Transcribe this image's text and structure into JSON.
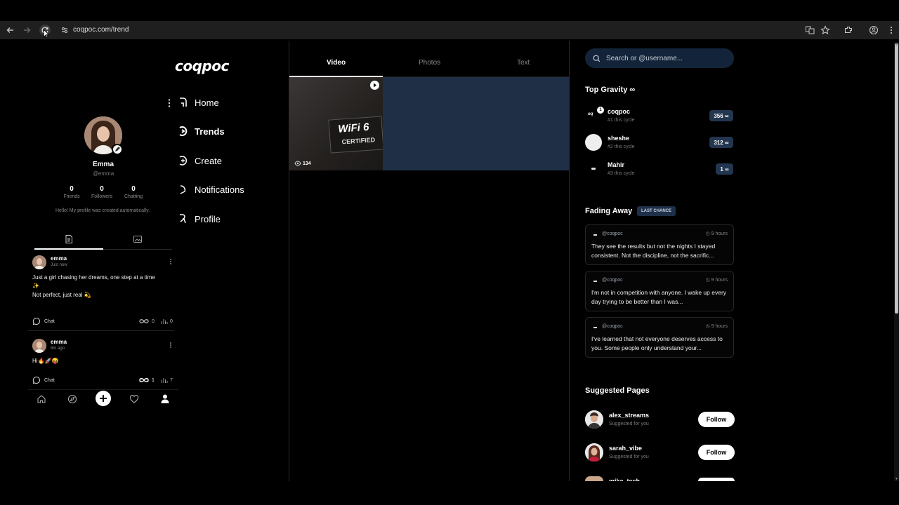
{
  "browser": {
    "url": "coqpoc.com/trend"
  },
  "brand": {
    "logo": "coqpoc"
  },
  "nav": {
    "items": [
      {
        "label": "Home"
      },
      {
        "label": "Trends"
      },
      {
        "label": "Create"
      },
      {
        "label": "Notifications"
      },
      {
        "label": "Profile"
      }
    ]
  },
  "profile": {
    "name": "Emma",
    "handle": "@emma",
    "stats": [
      {
        "value": "0",
        "label": "Friends"
      },
      {
        "value": "0",
        "label": "Followers"
      },
      {
        "value": "0",
        "label": "Chatting"
      }
    ],
    "bio": "Hello! My profile was created automatically."
  },
  "posts": [
    {
      "author": "emma",
      "time": "Just now",
      "line1": "Just a girl chasing her dreams, one step at a time",
      "line2": "✨",
      "line3": "Not perfect, just real 💫",
      "chat": "Chat",
      "gravity": "0",
      "views": "0"
    },
    {
      "author": "emma",
      "time": "8m ago",
      "line1": "Hi🔥🚀😝",
      "chat": "Chat",
      "gravity": "1",
      "views": "7"
    }
  ],
  "feed": {
    "tabs": [
      {
        "label": "Video"
      },
      {
        "label": "Photos"
      },
      {
        "label": "Text"
      }
    ],
    "video_views": "134",
    "thumb_line1": "WiFi 6",
    "thumb_line2": "CERTIFIED"
  },
  "search": {
    "placeholder": "Search or @username..."
  },
  "top_gravity": {
    "title": "Top Gravity ∞",
    "users": [
      {
        "name": "coqpoc",
        "rank": "#1 this cycle",
        "score": "356 ∞",
        "badge": "1"
      },
      {
        "name": "sheshe",
        "rank": "#2 this cycle",
        "score": "312 ∞"
      },
      {
        "name": "Mahir",
        "rank": "#3 this cycle",
        "score": "1 ∞"
      }
    ]
  },
  "fading": {
    "title": "Fading Away",
    "badge": "LAST CHANCE",
    "cards": [
      {
        "author": "@coqpoc",
        "time": "9 hours",
        "text": "They see the results but not the nights I stayed consistent. Not the discipline, not the sacrific..."
      },
      {
        "author": "@coqpoc",
        "time": "9 hours",
        "text": "I'm not in competition with anyone. I wake up every day trying to be better than I was..."
      },
      {
        "author": "@coqpoc",
        "time": "9 hours",
        "text": "I've learned that not everyone deserves access to you. Some people only understand your..."
      }
    ]
  },
  "suggested": {
    "title": "Suggested Pages",
    "items": [
      {
        "name": "alex_streams",
        "sub": "Suggested for you",
        "button": "Follow"
      },
      {
        "name": "sarah_vibe",
        "sub": "Suggested for you",
        "button": "Follow"
      },
      {
        "name": "mike_tech"
      }
    ]
  }
}
